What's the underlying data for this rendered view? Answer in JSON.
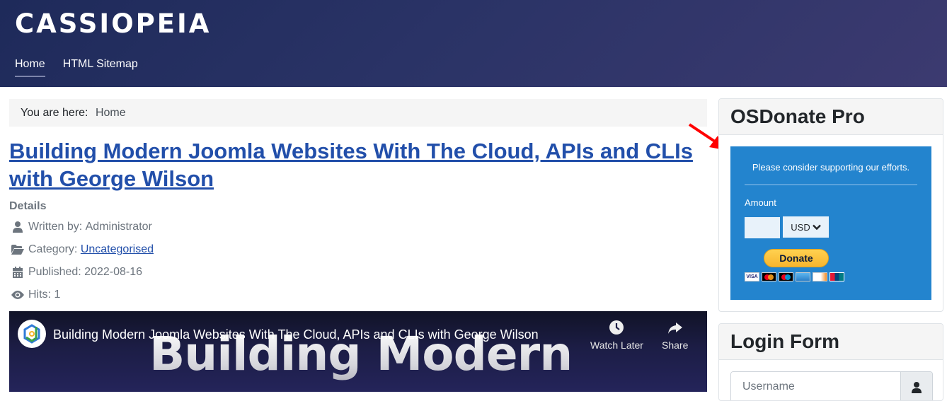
{
  "header": {
    "brand": "CASSIOPEIA",
    "nav": [
      {
        "label": "Home",
        "active": true
      },
      {
        "label": "HTML Sitemap",
        "active": false
      }
    ]
  },
  "breadcrumb": {
    "prefix": "You are here:",
    "current": "Home"
  },
  "article": {
    "title": "Building Modern Joomla Websites With The Cloud, APIs and CLIs with George Wilson",
    "details_heading": "Details",
    "written_by_label": "Written by: ",
    "author": "Administrator",
    "category_label": "Category: ",
    "category": "Uncategorised",
    "published_label": "Published: ",
    "published": "2022-08-16",
    "hits_label": "Hits: ",
    "hits": "1"
  },
  "video": {
    "title": "Building Modern Joomla Websites With The Cloud, APIs and CLIs with George Wilson",
    "thumbnail_text": "Building Modern",
    "watch_later": "Watch Later",
    "share": "Share"
  },
  "osdonate": {
    "heading": "OSDonate Pro",
    "intro": "Please consider supporting our efforts.",
    "amount_label": "Amount",
    "amount_value": "",
    "currency": "USD",
    "donate_button": "Donate",
    "cards": [
      "VISA",
      "Mastercard",
      "Maestro",
      "American Express",
      "Discover",
      "UnionPay"
    ],
    "box_color": "#2384ce"
  },
  "login": {
    "heading": "Login Form",
    "username_placeholder": "Username"
  },
  "annotation": {
    "arrow_color": "#ff0000"
  }
}
